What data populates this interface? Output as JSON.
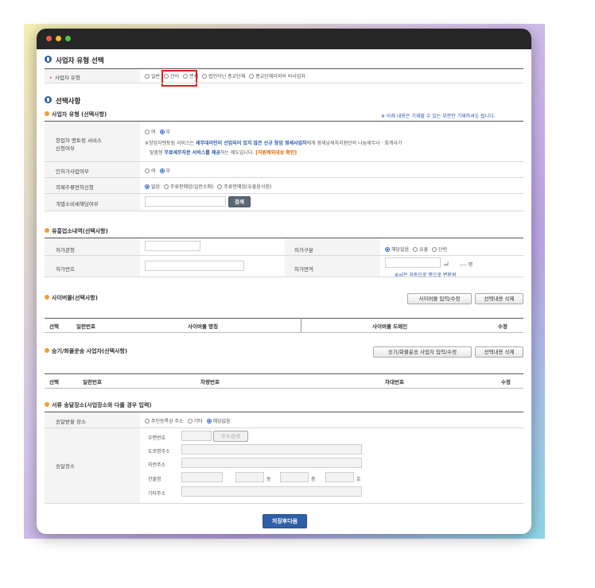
{
  "section1": {
    "title": "사업자 유형 선택",
    "row_label": "사업자 유형",
    "options": [
      "일반",
      "간이",
      "면세",
      "법인아닌 종교단체",
      "종교단체이외의 비사업자"
    ]
  },
  "section2": {
    "title": "선택사항",
    "note_right": "※ 아래 내용은 기재할 수 있는 부분만 기재하셔도 됩니다.",
    "sub1": {
      "title": "사업자 유형 (선택사항)",
      "mentoring_label": "창업자 멘토링 서비스 신청여부",
      "mentoring_label_1": "창업자 멘토링 서비스",
      "mentoring_label_2": "신청여부",
      "yes": "여",
      "no": "부",
      "mentoring_note_1a": "※창업자멘토링 서비스는 ",
      "mentoring_note_1b": "세무대리인이 선임되어 있지 않은 신규 창업 영세사업자",
      "mentoring_note_1c": "에게 영세납세자지원단의 나눔세무사 · 회계사가",
      "mentoring_note_2a": "맞춤형 ",
      "mentoring_note_2b": "무료세무자문 서비스를 제공",
      "mentoring_note_2c": "하는 제도입니다. ",
      "mentoring_note_2d": "[지원예외대상 확인]",
      "permit_label": "인허가사업여부",
      "liquor_label": "의제주류면허신청",
      "liquor_options": [
        "없음",
        "주류판매업(일반소매)",
        "주류판매업(유흥음식점)"
      ],
      "excise_label": "개별소비세해당여부",
      "search_button": "검색"
    },
    "sub2": {
      "title": "유흥업소내역(선택사항)",
      "office_label": "허가관청",
      "type_label": "허가구분",
      "type_options": [
        "해당없음",
        "유흥",
        "단란"
      ],
      "number_label": "허가번호",
      "area_label": "허가면적",
      "unit_m2": "㎡",
      "unit_pyeong": "---- 평",
      "area_note": "※㎡은 자동으로 평으로 변환됨"
    },
    "sub3": {
      "title": "사이버몰(선택사항)",
      "input_button": "사이버몰 입력/수정",
      "delete_button": "선택내용 삭제",
      "columns": [
        "선택",
        "일련번호",
        "사이버몰 명칭",
        "사이버몰 도메인",
        "수정"
      ]
    },
    "sub4": {
      "title": "승기/화물운송 사업자(선택사항)",
      "input_button": "승기/화물운송 사업자 입력/수정",
      "delete_button": "선택내용 삭제",
      "columns": [
        "선택",
        "일련번호",
        "차량번호",
        "차대번호",
        "수정"
      ]
    },
    "sub5": {
      "title": "서류 송달장소(사업장소와 다를 경우 입력)",
      "place_label": "송달받을 장소",
      "place_options": [
        "주민등록상 주소",
        "기타",
        "해당없음"
      ],
      "addr_label": "송달장소",
      "zip_label": "우편번호",
      "zip_button": "주소검색",
      "road_label": "도로명주소",
      "lot_label": "지번주소",
      "building_label": "건물명",
      "dong": "동",
      "floor": "층",
      "ho": "호",
      "other_label": "기타주소"
    }
  },
  "footer": {
    "save_button": "저장후다음"
  }
}
